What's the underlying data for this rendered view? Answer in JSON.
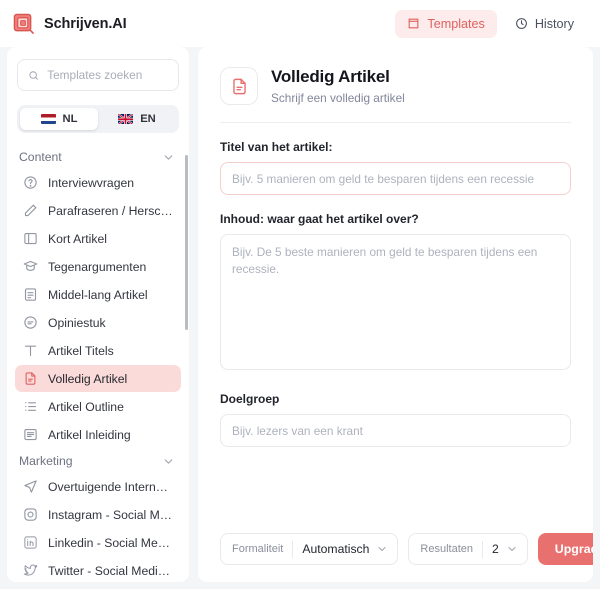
{
  "header": {
    "brand_name": "Schrijven.AI",
    "logo_icon": "stacked-squares-logo",
    "nav": [
      {
        "label": "Templates",
        "icon": "book-icon",
        "active": true
      },
      {
        "label": "History",
        "icon": "clock-icon",
        "active": false
      }
    ]
  },
  "sidebar": {
    "search": {
      "placeholder": "Templates zoeken",
      "value": "",
      "icon": "search-icon"
    },
    "language": {
      "options": [
        {
          "code": "NL",
          "label": "NL",
          "flag": "flag-nl",
          "selected": true
        },
        {
          "code": "EN",
          "label": "EN",
          "flag": "flag-gb",
          "selected": false
        }
      ]
    },
    "groups": [
      {
        "title": "Content",
        "collapse_icon": "chevron-down-icon",
        "items": [
          {
            "label": "Interviewvragen",
            "icon": "question-circle-icon",
            "selected": false
          },
          {
            "label": "Parafraseren / Herschrij...",
            "icon": "pencil-icon",
            "selected": false
          },
          {
            "label": "Kort Artikel",
            "icon": "layout-icon",
            "selected": false
          },
          {
            "label": "Tegenargumenten",
            "icon": "graduation-cap-icon",
            "selected": false
          },
          {
            "label": "Middel-lang Artikel",
            "icon": "document-lines-icon",
            "selected": false
          },
          {
            "label": "Opiniestuk",
            "icon": "speech-bubble-icon",
            "selected": false
          },
          {
            "label": "Artikel Titels",
            "icon": "text-t-icon",
            "selected": false
          },
          {
            "label": "Volledig Artikel",
            "icon": "file-text-icon",
            "selected": true
          },
          {
            "label": "Artikel Outline",
            "icon": "list-icon",
            "selected": false
          },
          {
            "label": "Artikel Inleiding",
            "icon": "paragraph-icon",
            "selected": false
          }
        ]
      },
      {
        "title": "Marketing",
        "collapse_icon": "chevron-down-icon",
        "items": [
          {
            "label": "Overtuigende Interne e...",
            "icon": "send-icon",
            "selected": false
          },
          {
            "label": "Instagram - Social Medi...",
            "icon": "instagram-icon",
            "selected": false
          },
          {
            "label": "Linkedin - Social Media...",
            "icon": "linkedin-icon",
            "selected": false
          },
          {
            "label": "Twitter - Social Media ...",
            "icon": "twitter-icon",
            "selected": false
          }
        ]
      }
    ]
  },
  "main": {
    "template": {
      "icon": "file-text-icon",
      "title": "Volledig Artikel",
      "subtitle": "Schrijf een volledig artikel"
    },
    "fields": {
      "title": {
        "label": "Titel van het artikel:",
        "placeholder": "Bijv. 5 manieren om geld te besparen tijdens een recessie",
        "value": ""
      },
      "content": {
        "label": "Inhoud: waar gaat het artikel over?",
        "placeholder": "Bijv. De 5 beste manieren om geld te besparen tijdens een recessie.",
        "value": ""
      },
      "audience": {
        "label": "Doelgroep",
        "placeholder": "Bijv. lezers van een krant",
        "value": ""
      }
    },
    "footer": {
      "formality": {
        "label": "Formaliteit",
        "value": "Automatisch",
        "icon": "chevron-down-icon"
      },
      "results": {
        "label": "Resultaten",
        "value": "2",
        "icon": "chevron-down-icon"
      },
      "upgrade_label": "Upgrade"
    }
  },
  "colors": {
    "accent": "#e8716f",
    "accent_soft": "#fbdbd9",
    "accent_tab": "#fdeceb",
    "page_bg": "#f4f5f7"
  }
}
